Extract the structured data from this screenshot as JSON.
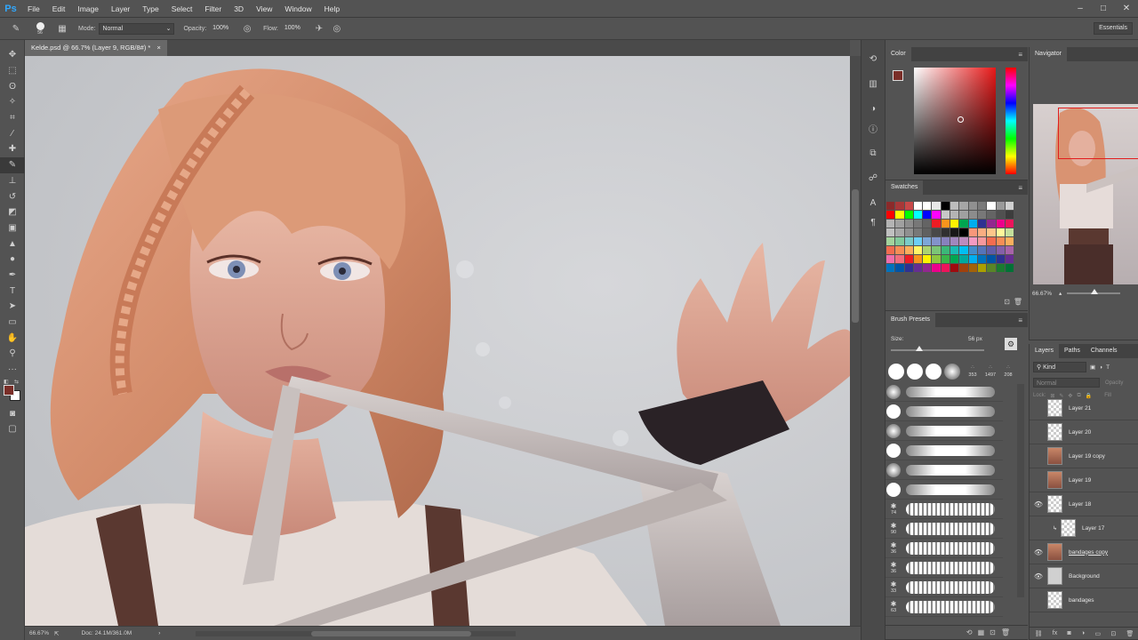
{
  "app": {
    "logo": "Ps"
  },
  "menu": [
    "File",
    "Edit",
    "Image",
    "Layer",
    "Type",
    "Select",
    "Filter",
    "3D",
    "View",
    "Window",
    "Help"
  ],
  "options": {
    "brush_size": "56",
    "mode_label": "Mode:",
    "mode_value": "Normal",
    "opacity_label": "Opacity:",
    "opacity_value": "100%",
    "flow_label": "Flow:",
    "flow_value": "100%",
    "workspace": "Essentials"
  },
  "document": {
    "tab_title": "Kelde.psd @ 66.7% (Layer 9, RGB/8#) *",
    "zoom": "66.67%",
    "doc_info": "Doc: 24.1M/361.0M"
  },
  "panels": {
    "color_tab": "Color",
    "swatches_tab": "Swatches",
    "brush_presets_tab": "Brush Presets",
    "size_label": "Size:",
    "size_value": "56 px",
    "navigator_tab": "Navigator",
    "navigator_zoom": "66.67%",
    "layers_tab": "Layers",
    "paths_tab": "Paths",
    "channels_tab": "Channels",
    "kind_filter": "Kind",
    "blend_mode": "Normal",
    "opacity_label": "Opacity",
    "lock_label": "Lock:",
    "fill_label": "Fill"
  },
  "colors": {
    "foreground": "#7a2e28",
    "background": "#ffffff"
  },
  "brush_presets": {
    "top_sizes": [
      "353",
      "1497",
      "208"
    ],
    "row_numbers": [
      "",
      "",
      "",
      "",
      "",
      "",
      "74",
      "90",
      "36",
      "36",
      "33",
      "63"
    ]
  },
  "layers": [
    {
      "name": "Layer 21",
      "visible": false,
      "thumb": "checker"
    },
    {
      "name": "Layer 20",
      "visible": false,
      "thumb": "checker"
    },
    {
      "name": "Layer 19 copy",
      "visible": false,
      "thumb": "portrait"
    },
    {
      "name": "Layer 19",
      "visible": false,
      "thumb": "portrait"
    },
    {
      "name": "Layer 18",
      "visible": true,
      "thumb": "checker"
    },
    {
      "name": "Layer 17",
      "visible": false,
      "thumb": "checker"
    },
    {
      "name": "bandages copy",
      "visible": true,
      "thumb": "portrait"
    },
    {
      "name": "Background",
      "visible": true,
      "thumb": "gray"
    },
    {
      "name": "bandages",
      "visible": false,
      "thumb": "checker"
    }
  ]
}
